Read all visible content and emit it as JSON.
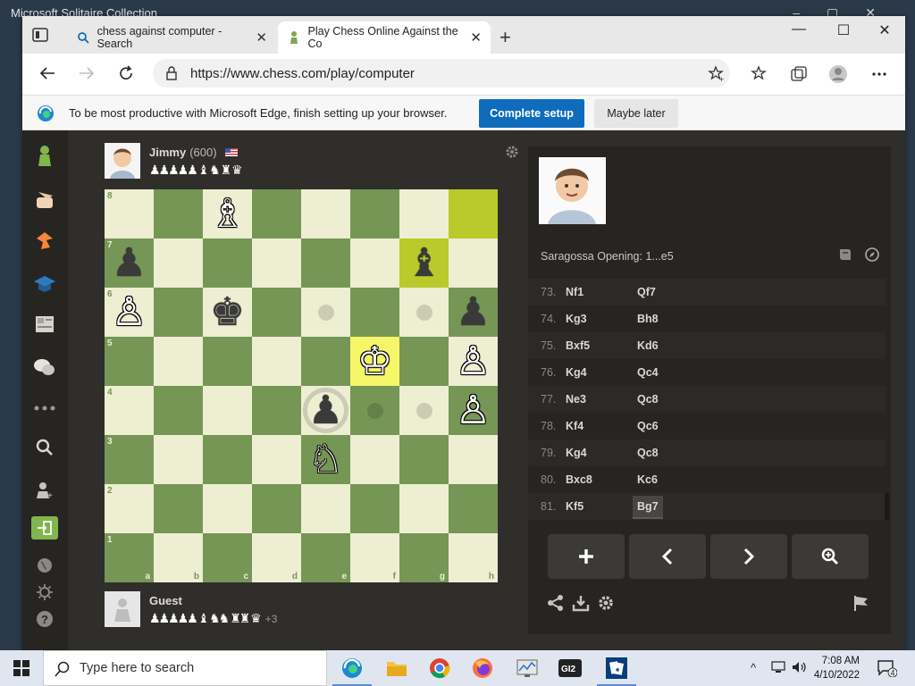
{
  "background_app": {
    "title": "Microsoft Solitaire Collection"
  },
  "browser": {
    "tabs": [
      {
        "label": "chess against computer - Search",
        "icon": "search-icon"
      },
      {
        "label": "Play Chess Online Against the Co",
        "icon": "chess-pawn-icon",
        "active": true
      }
    ],
    "url": "https://www.chess.com/play/computer",
    "infobar": {
      "message": "To be most productive with Microsoft Edge, finish setting up your browser.",
      "primary_button": "Complete setup",
      "secondary_button": "Maybe later"
    }
  },
  "game": {
    "top_player": {
      "name": "Jimmy",
      "rating": "(600)",
      "flag": "us-flag-icon",
      "captured": "♟♟♟♟♟ ♝ ♞ ♜ ♛"
    },
    "bottom_player": {
      "name": "Guest",
      "captured": "♟♟♟♟♟ ♝ ♞♞ ♜♜ ♛",
      "advantage": "+3"
    },
    "files": [
      "a",
      "b",
      "c",
      "d",
      "e",
      "f",
      "g",
      "h"
    ],
    "ranks": [
      "8",
      "7",
      "6",
      "5",
      "4",
      "3",
      "2",
      "1"
    ],
    "pieces": {
      "c8": "wB",
      "a7": "bP",
      "g7": "bB",
      "a6": "wP",
      "c6": "bK",
      "h6": "bP",
      "f5": "wK",
      "h5": "wP",
      "e4": "bP",
      "h4": "wP",
      "e3": "wN"
    },
    "highlights": [
      "h8",
      "g7"
    ],
    "selected": "f5",
    "hints": [
      "e6",
      "g6",
      "g4",
      "f4"
    ],
    "capture_hints": [
      "e4"
    ]
  },
  "panel": {
    "opening": "Saragossa Opening: 1...e5",
    "moves": [
      {
        "num": "73.",
        "white": "Nf1",
        "black": "Qf7"
      },
      {
        "num": "74.",
        "white": "Kg3",
        "black": "Bh8"
      },
      {
        "num": "75.",
        "white": "Bxf5",
        "black": "Kd6"
      },
      {
        "num": "76.",
        "white": "Kg4",
        "black": "Qc4"
      },
      {
        "num": "77.",
        "white": "Ne3",
        "black": "Qc8"
      },
      {
        "num": "78.",
        "white": "Kf4",
        "black": "Qc6"
      },
      {
        "num": "79.",
        "white": "Kg4",
        "black": "Qc8"
      },
      {
        "num": "80.",
        "white": "Bxc8",
        "black": "Kc6"
      },
      {
        "num": "81.",
        "white": "Kf5",
        "black": "Bg7",
        "active": true
      }
    ],
    "controls": [
      "+",
      "‹",
      "›",
      "⊕"
    ]
  },
  "taskbar": {
    "search_placeholder": "Type here to search",
    "time": "7:08 AM",
    "date": "4/10/2022",
    "notifications": "4"
  }
}
